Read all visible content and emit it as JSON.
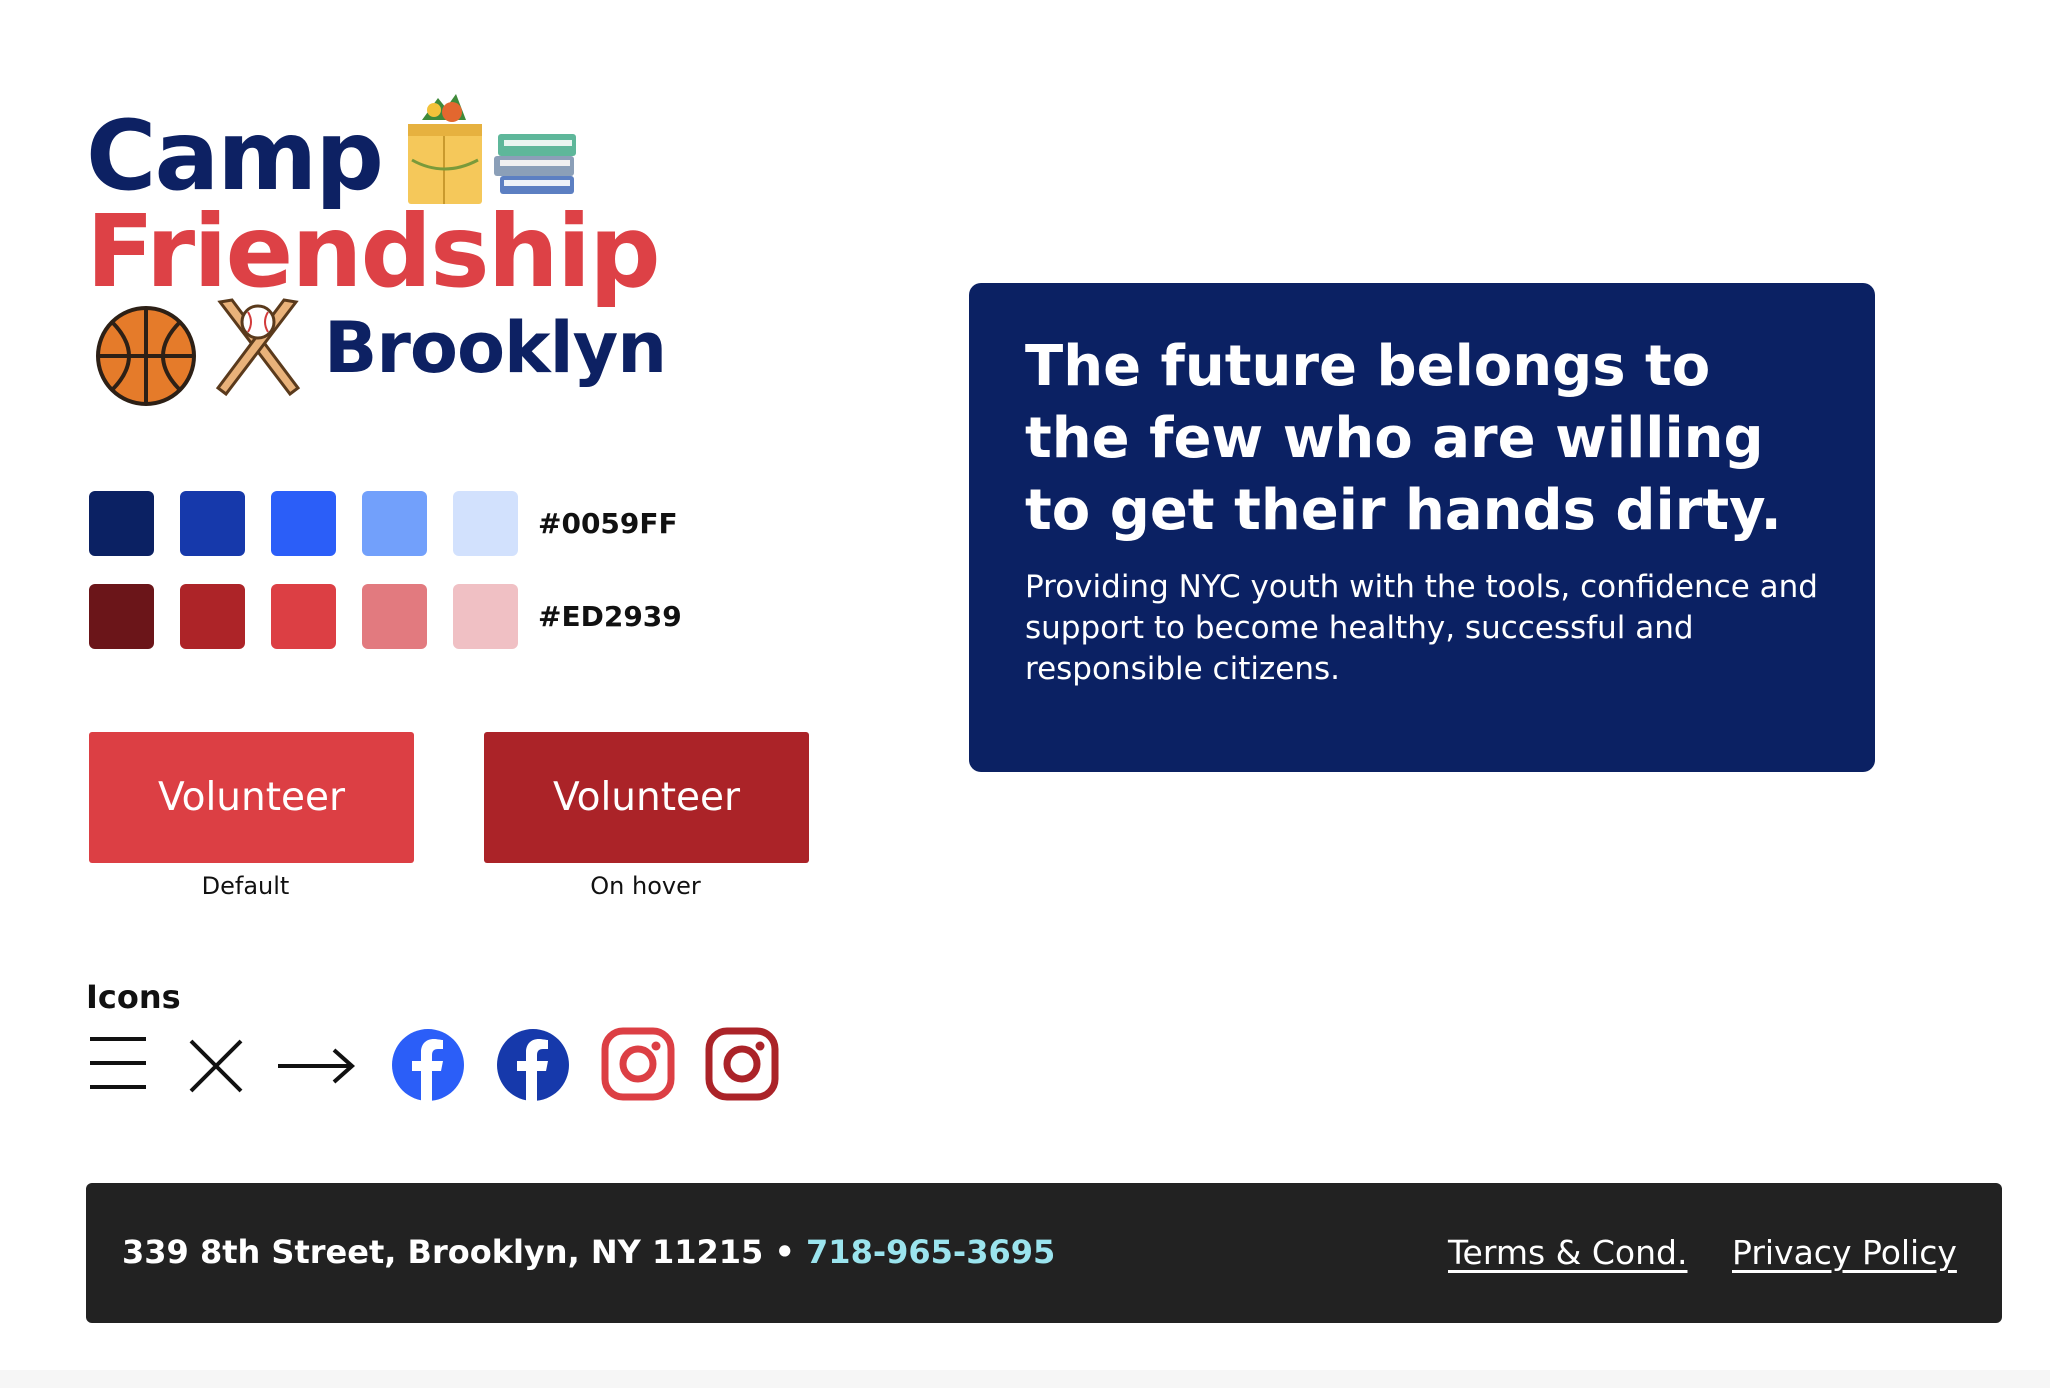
{
  "logo": {
    "line1": "Camp",
    "line2": "Friendship",
    "line3": "Brooklyn",
    "icons": [
      "grocery-bag-icon",
      "books-icon",
      "basketball-icon",
      "baseball-bats-icon"
    ]
  },
  "palette": {
    "blue": {
      "label": "#0059FF",
      "swatches": [
        "#0b2163",
        "#1639ab",
        "#2b5ef8",
        "#72a0fb",
        "#d2e1fd"
      ]
    },
    "red": {
      "label": "#ED2939",
      "swatches": [
        "#6b1519",
        "#ad2428",
        "#dc3f44",
        "#e27a7f",
        "#f0c0c4"
      ]
    }
  },
  "buttons": {
    "default": {
      "label": "Volunteer",
      "caption": "Default",
      "color": "#dc3f44"
    },
    "hover": {
      "label": "Volunteer",
      "caption": "On hover",
      "color": "#ab2328"
    }
  },
  "icons": {
    "title": "Icons",
    "items": [
      "menu-icon",
      "close-icon",
      "arrow-right-icon",
      "facebook-icon",
      "facebook-icon",
      "instagram-icon",
      "instagram-icon"
    ],
    "colors": {
      "facebook_default": "#2b5ef8",
      "facebook_hover": "#1639ab",
      "instagram_default": "#dc3f44",
      "instagram_hover": "#ab2328"
    }
  },
  "card": {
    "headline": "The future belongs to the few who are willing to get their hands dirty.",
    "body": "Providing NYC youth with the tools, confidence and support to become healthy, successful and responsible citizens.",
    "background": "#0b2163"
  },
  "footer": {
    "address": "339 8th Street, Brooklyn, NY 11215 • ",
    "phone": "718-965-3695",
    "terms": "Terms & Cond.",
    "privacy": "Privacy Policy",
    "background": "#222222",
    "phone_color": "#9be4ee"
  }
}
